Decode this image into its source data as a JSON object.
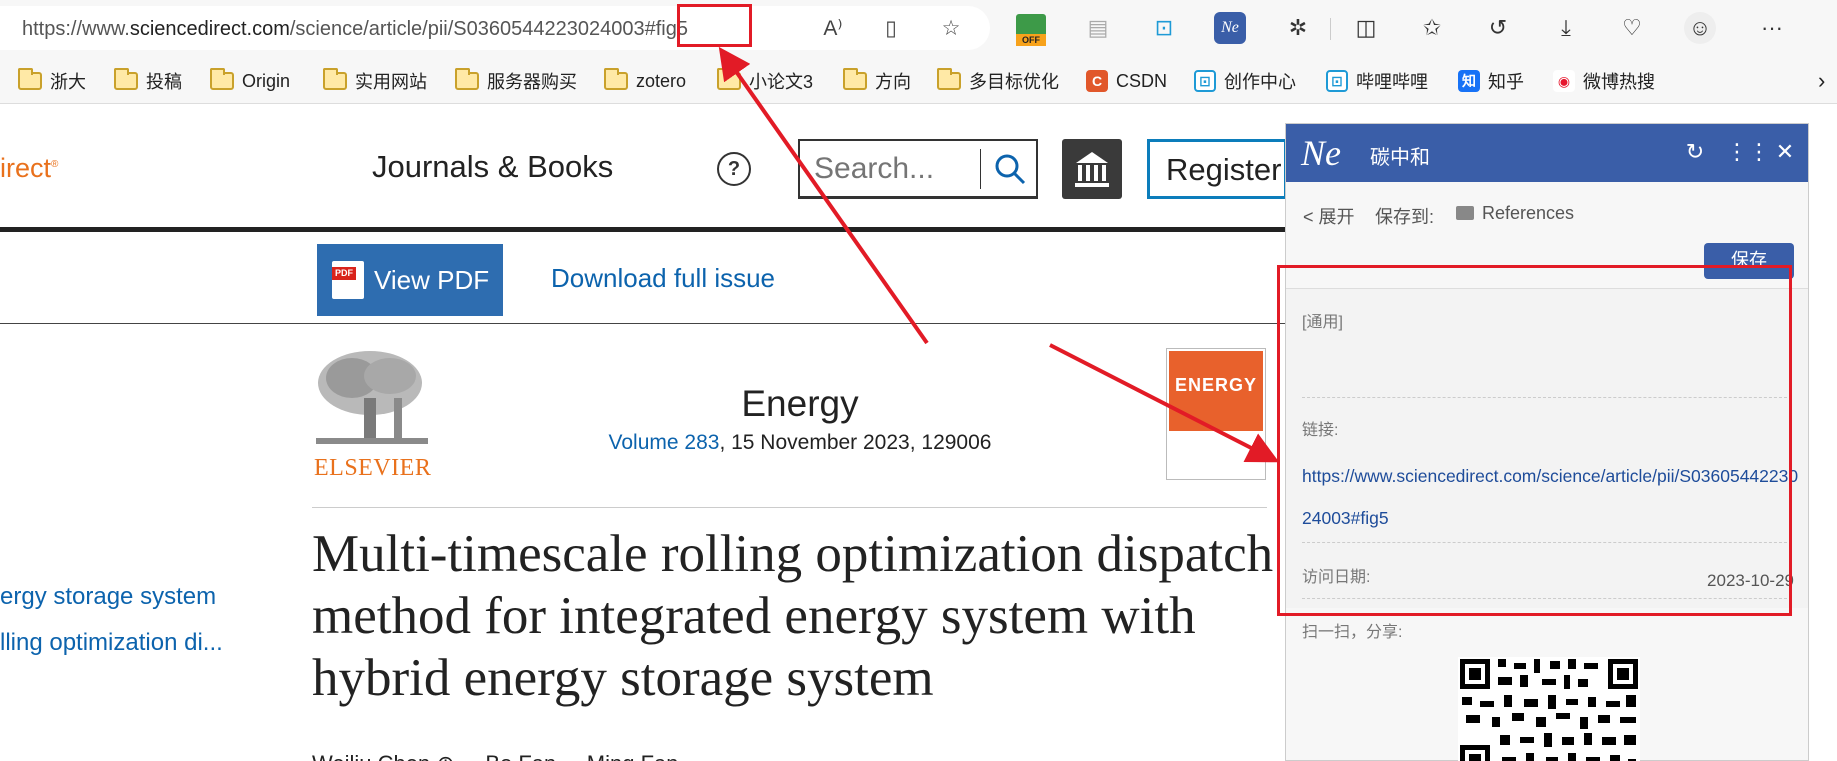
{
  "browser": {
    "url_prefix": "https://www.",
    "url_host": "sciencedirect.com",
    "url_path": "/science/article/pii/S0360544223024003",
    "url_fragment": "#fig5",
    "extension_badge": "OFF"
  },
  "bookmarks": [
    {
      "label": "浙大",
      "icon": "folder-icon"
    },
    {
      "label": "投稿",
      "icon": "folder-icon"
    },
    {
      "label": "Origin",
      "icon": "folder-icon"
    },
    {
      "label": "实用网站",
      "icon": "folder-icon"
    },
    {
      "label": "服务器购买",
      "icon": "folder-icon"
    },
    {
      "label": "zotero",
      "icon": "folder-icon"
    },
    {
      "label": "小论文3",
      "icon": "folder-icon"
    },
    {
      "label": "方向",
      "icon": "folder-icon"
    },
    {
      "label": "多目标优化",
      "icon": "folder-icon"
    },
    {
      "label": "CSDN",
      "icon": "csdn-icon"
    },
    {
      "label": "创作中心",
      "icon": "bilibili-icon"
    },
    {
      "label": "哔哩哔哩",
      "icon": "bilibili-icon"
    },
    {
      "label": "知乎",
      "icon": "zhihu-icon"
    },
    {
      "label": "微博热搜",
      "icon": "weibo-icon"
    }
  ],
  "site": {
    "logo_fragment": "irect",
    "nav_journals": "Journals & Books",
    "search_placeholder": "Search...",
    "register_label": "Register"
  },
  "article_toolbar": {
    "view_pdf": "View PDF",
    "download_issue": "Download full issue"
  },
  "journal": {
    "publisher": "ELSEVIER",
    "name": "Energy",
    "volume": "Volume 283",
    "details": ", 15 November 2023, 129006",
    "cover_word": "ENERGY"
  },
  "article": {
    "title": "Multi-timescale rolling optimization dispatch method for integrated energy system with hybrid energy storage system",
    "authors_partial": "Weiliu Chen ⊕ ... Bo Fan ... Ming Fan"
  },
  "toc": {
    "item1": "ergy storage system",
    "item2": "lling optimization di..."
  },
  "panel": {
    "logo": "Ne",
    "title": "碳中和",
    "expand": "< 展开",
    "save_to_label": "保存到:",
    "folder": "References",
    "save_button": "保存",
    "type_label": "[通用]",
    "link_label": "链接:",
    "link_url": "https://www.sciencedirect.com/science/article/pii/S0360544223024003#fig5",
    "date_label": "访问日期:",
    "date_value": "2023-10-29",
    "share_label": "扫一扫，分享:"
  },
  "colors": {
    "panel_header": "#3a5ea8",
    "sciencedirect_orange": "#e9711c",
    "link_blue": "#0c63ad",
    "annotation_red": "#e21b26"
  }
}
